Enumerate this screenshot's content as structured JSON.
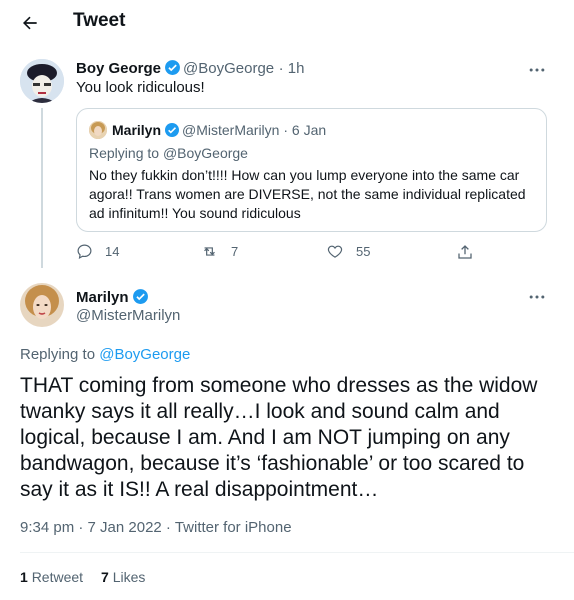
{
  "header": {
    "title": "Tweet"
  },
  "parent_tweet": {
    "name": "Boy George",
    "handle": "@BoyGeorge",
    "time": "· 1h",
    "text": "You look ridiculous!",
    "quote": {
      "name": "Marilyn",
      "handle": "@MisterMarilyn",
      "time": "· 6 Jan",
      "replying_prefix": "Replying to ",
      "replying_to": "@BoyGeorge",
      "text": "No they fukkin don’t!!!! How can you lump everyone into the same car agora!! Trans women are DIVERSE, not the same individual replicated ad infinitum!! You sound ridiculous"
    },
    "actions": {
      "replies": "14",
      "retweets": "7",
      "likes": "55"
    }
  },
  "main_tweet": {
    "name": "Marilyn",
    "handle": "@MisterMarilyn",
    "replying_prefix": "Replying to ",
    "replying_to": "@BoyGeorge",
    "text": "THAT coming from someone who dresses as the widow twanky says it all really…I look and sound calm and logical, because I am. And I am NOT jumping on any bandwagon, because it’s  ‘fashionable’ or too scared to say it as it IS!! A real disappointment…",
    "time": "9:34 pm · 7 Jan 2022 · ",
    "source": "Twitter for iPhone",
    "retweets_count": "1",
    "retweets_label": "Retweet",
    "likes_count": "7",
    "likes_label": "Likes"
  },
  "colors": {
    "accent": "#1d9bf0",
    "text": "#0f1419",
    "secondary": "#536471",
    "border": "#cfd9de"
  },
  "icons": [
    "back-arrow-icon",
    "verified-badge-icon",
    "more-icon",
    "reply-icon",
    "retweet-icon",
    "like-icon",
    "share-icon"
  ]
}
